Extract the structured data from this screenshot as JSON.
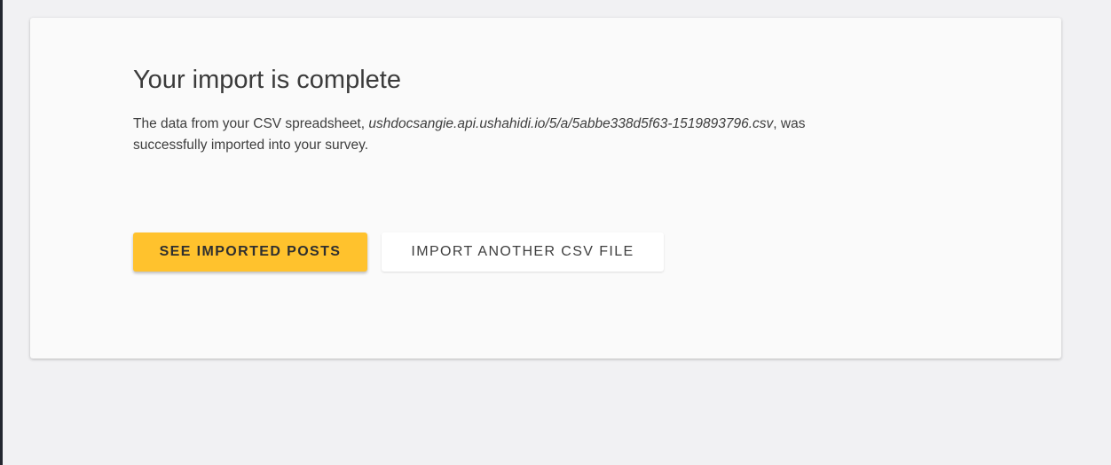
{
  "card": {
    "title": "Your import is complete",
    "message_prefix": "The data from your CSV spreadsheet, ",
    "file_name": "ushdocsangie.api.ushahidi.io/5/a/5abbe338d5f63-1519893796.csv",
    "message_suffix_line1": ", was",
    "message_line2": "successfully imported into your survey."
  },
  "actions": {
    "see_posts_label": "SEE IMPORTED POSTS",
    "import_another_label": "IMPORT ANOTHER CSV FILE"
  },
  "colors": {
    "primary": "#ffc22d",
    "background": "#f1f1f3",
    "card": "#fafafa"
  }
}
